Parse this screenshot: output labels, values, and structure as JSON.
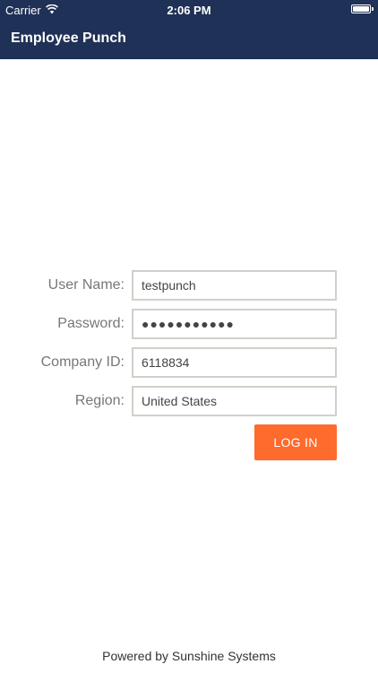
{
  "status_bar": {
    "carrier": "Carrier",
    "time": "2:06 PM",
    "wifi_icon": "wifi-icon",
    "battery_icon": "battery-icon",
    "battery_level": 1.0
  },
  "header": {
    "title": "Employee Punch",
    "background_color": "#1f3156"
  },
  "form": {
    "user_name_label": "User Name:",
    "user_name_value": "testpunch",
    "password_label": "Password:",
    "password_value": "●●●●●●●●●●●",
    "company_id_label": "Company ID:",
    "company_id_value": "6118834",
    "region_label": "Region:",
    "region_value": "United States"
  },
  "actions": {
    "login_label": "LOG IN",
    "login_color": "#ff6b2c"
  },
  "footer": {
    "text": "Powered by Sunshine Systems"
  }
}
